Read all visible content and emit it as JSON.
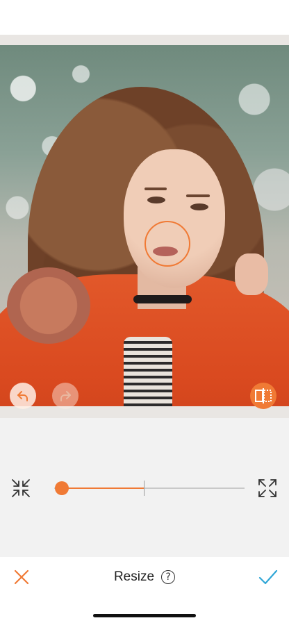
{
  "editor": {
    "title": "Resize",
    "help_icon_glyph": "?",
    "accent_color": "#f07a35"
  },
  "toolbar": {
    "undo_icon": "undo-icon",
    "redo_icon": "redo-icon",
    "compare_icon": "compare-icon"
  },
  "resize_slider": {
    "value_fraction": 0.04,
    "center_marker_fraction": 0.47,
    "min_icon": "shrink-icon",
    "max_icon": "expand-icon"
  },
  "actions": {
    "cancel_icon": "close-icon",
    "apply_icon": "check-icon"
  }
}
